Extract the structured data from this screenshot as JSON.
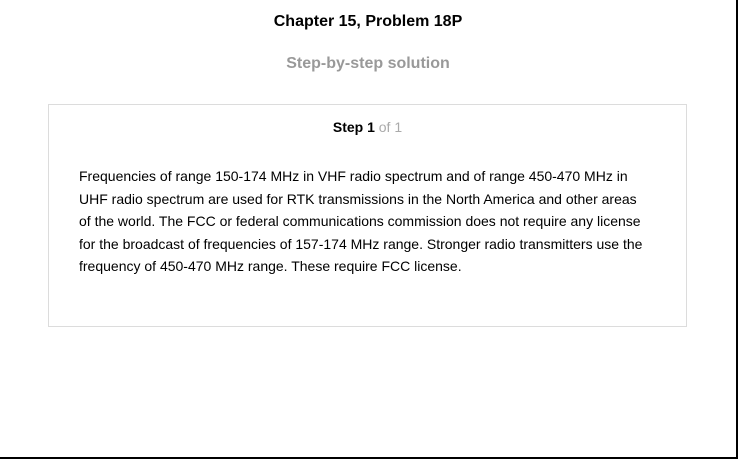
{
  "header": {
    "title": "Chapter 15, Problem 18P",
    "subtitle": "Step-by-step solution"
  },
  "step": {
    "label": "Step 1",
    "of_text": "of 1",
    "lines": [
      "Frequencies of range 150-174 MHz in VHF radio spectrum and of range 450-470 MHz in",
      "UHF radio spectrum are used for RTK transmissions in the North America and other areas",
      "of the world. The FCC or federal communications commission does not require any license",
      "for the broadcast of frequencies of 157-174 MHz range. Stronger radio transmitters use the",
      "frequency of 450-470 MHz range. These require FCC license."
    ]
  }
}
